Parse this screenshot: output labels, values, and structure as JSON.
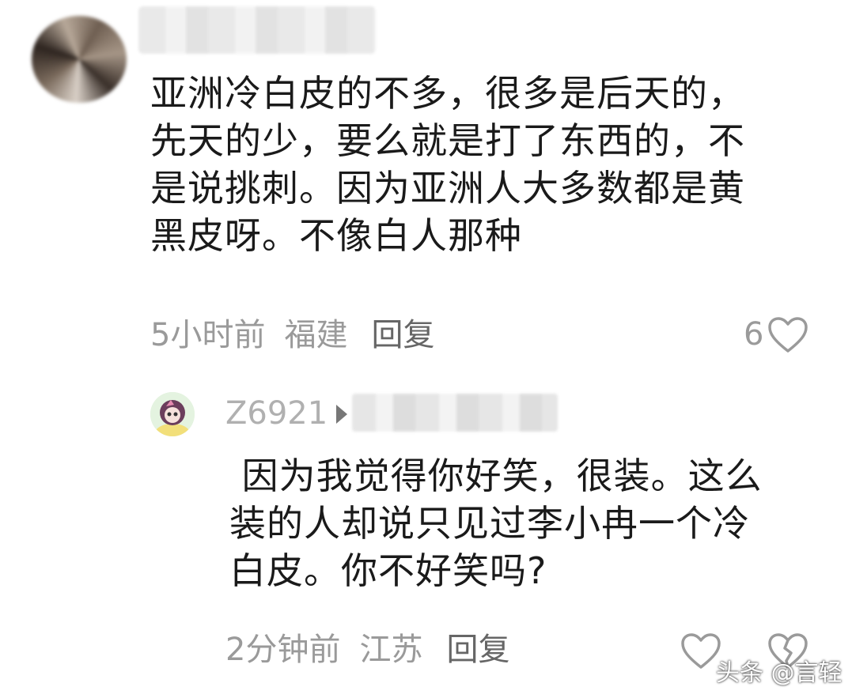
{
  "comment1": {
    "text_lines": [
      "亚洲冷白皮的不多，很多是后天的，",
      "先天的少，要么就是打了东西的，不",
      "是说挑刺。因为亚洲人大多数都是黄",
      "黑皮呀。不像白人那种"
    ],
    "time": "5小时前",
    "location": "福建",
    "reply_label": "回复",
    "likes": "6"
  },
  "reply1": {
    "username": "Z6921",
    "text_lines": [
      " 因为我觉得你好笑，很装。这么",
      "装的人却说只见过李小冉一个冷",
      "白皮。你不好笑吗?"
    ],
    "time": "2分钟前",
    "location": "江苏",
    "reply_label": "回复"
  },
  "watermark": "头条 @言轻",
  "colors": {
    "meta": "#9a9a9a",
    "text": "#1a1a1a"
  }
}
